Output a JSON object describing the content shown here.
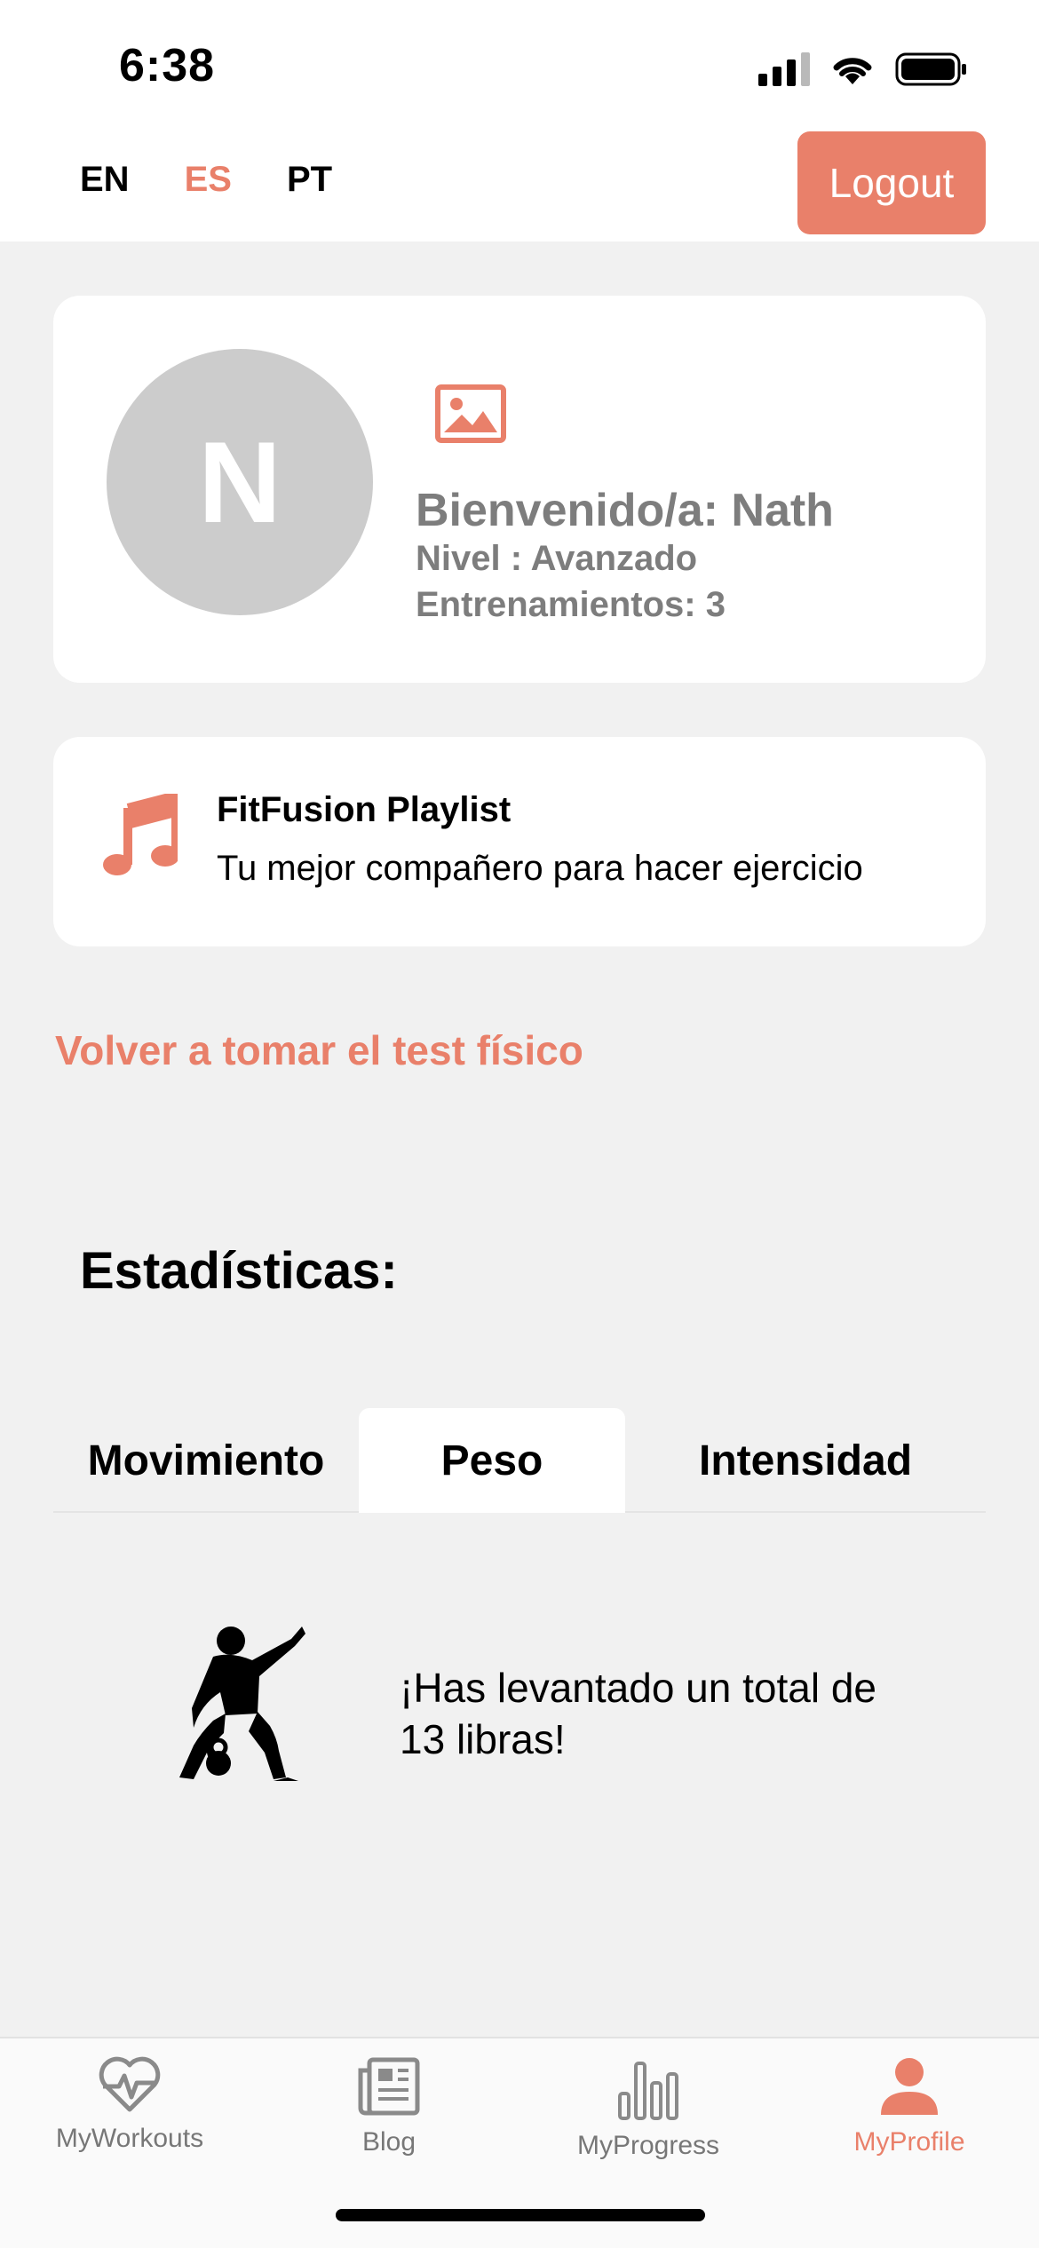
{
  "status_bar": {
    "time": "6:38"
  },
  "header": {
    "languages": [
      {
        "code": "EN",
        "active": false
      },
      {
        "code": "ES",
        "active": true
      },
      {
        "code": "PT",
        "active": false
      }
    ],
    "logout_label": "Logout"
  },
  "profile": {
    "avatar_initial": "N",
    "welcome": "Bienvenido/a: Nath",
    "level": "Nivel : Avanzado",
    "workouts": "Entrenamientos: 3"
  },
  "playlist": {
    "title": "FitFusion Playlist",
    "subtitle": "Tu mejor compañero para hacer ejercicio"
  },
  "retake_test_link": "Volver a tomar el test físico",
  "stats": {
    "title": "Estadísticas:",
    "tabs": [
      {
        "label": "Movimiento",
        "active": false
      },
      {
        "label": "Peso",
        "active": true
      },
      {
        "label": "Intensidad",
        "active": false
      }
    ],
    "message_line1": "¡Has levantado un total de",
    "message_line2": "13 libras!"
  },
  "bottom_nav": [
    {
      "label": "MyWorkouts",
      "icon": "heart-pulse-icon",
      "active": false
    },
    {
      "label": "Blog",
      "icon": "newspaper-icon",
      "active": false
    },
    {
      "label": "MyProgress",
      "icon": "bar-chart-icon",
      "active": false
    },
    {
      "label": "MyProfile",
      "icon": "person-icon",
      "active": true
    }
  ],
  "colors": {
    "accent": "#e9806a",
    "background": "#f1f1f1",
    "card": "#ffffff",
    "muted_text": "#7d7d7d",
    "avatar": "#cccccc"
  }
}
